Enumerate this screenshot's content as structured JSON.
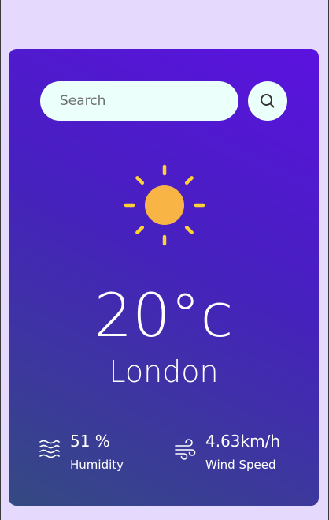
{
  "search": {
    "placeholder": "Search",
    "value": "",
    "button_icon": "search-icon"
  },
  "weather": {
    "icon": "sun-icon",
    "temperature": "20°c",
    "city": "London"
  },
  "details": {
    "humidity": {
      "icon": "humidity-waves-icon",
      "value": "51 %",
      "label": "Humidity"
    },
    "wind": {
      "icon": "wind-icon",
      "value": "4.63km/h",
      "label": "Wind Speed"
    }
  },
  "colors": {
    "page_background": "#e5d9fd",
    "card_gradient_top": "#5b12df",
    "card_gradient_bottom": "#344a82",
    "input_background": "#ebfffb",
    "sun_core": "#f8b545",
    "sun_rays": "#fcd236",
    "text": "#ffffff"
  }
}
